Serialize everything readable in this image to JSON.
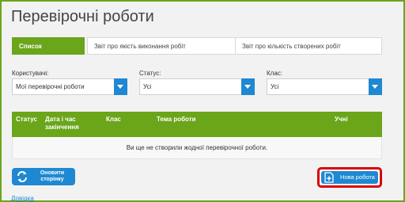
{
  "page": {
    "title": "Перевірочні роботи"
  },
  "tabs": [
    {
      "label": "Список",
      "active": true
    },
    {
      "label": "Звіт про якість виконання робіт",
      "active": false
    },
    {
      "label": "Звіт про кількість створених робіт",
      "active": false
    }
  ],
  "filters": {
    "users": {
      "label": "Користувачі:",
      "value": "Мої перевірочні роботи"
    },
    "status": {
      "label": "Статус:",
      "value": "Усі"
    },
    "class": {
      "label": "Клас:",
      "value": "Усі"
    }
  },
  "table": {
    "headers": [
      "Статус",
      "Дата і час закінчення",
      "Клас",
      "Тема роботи",
      "Учні"
    ],
    "empty_message": "Ви ще не створили жодної перевірочної роботи."
  },
  "actions": {
    "refresh_label": "Оновити сторінку",
    "new_label": "Нова робота"
  },
  "footer": {
    "help_link": "Довідка"
  },
  "colors": {
    "accent_green": "#6aa51a",
    "accent_blue": "#1e88d2",
    "highlight_red": "#d90000"
  },
  "icons": {
    "refresh": "refresh-icon",
    "new_work": "add-document-icon",
    "dropdown": "chevron-down-icon"
  }
}
